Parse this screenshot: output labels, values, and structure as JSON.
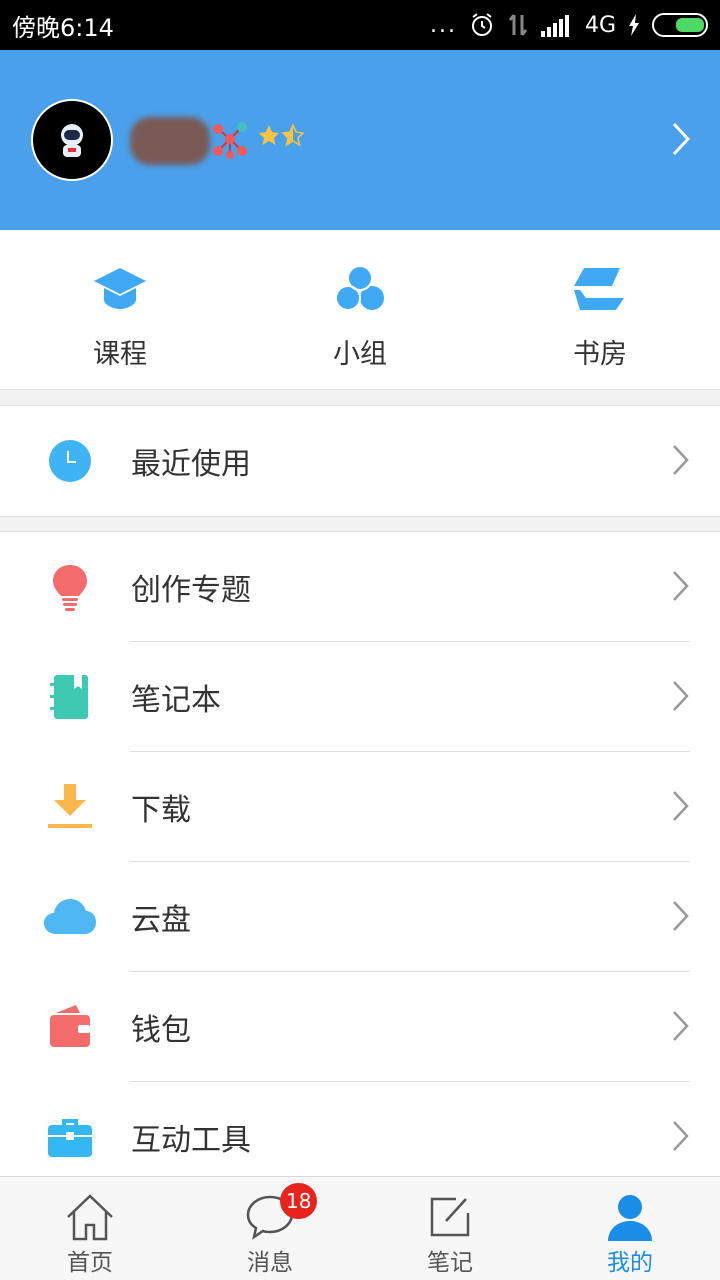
{
  "status_bar": {
    "time": "傍晚6:14",
    "dots": "...",
    "network": "4G"
  },
  "header": {
    "avatar_icon": "astronaut-icon",
    "username": "",
    "stars": 1.5
  },
  "quick_nav": [
    {
      "label": "课程",
      "icon": "graduation-cap-icon",
      "color": "#3fa9f5"
    },
    {
      "label": "小组",
      "icon": "group-circles-icon",
      "color": "#3fa9f5"
    },
    {
      "label": "书房",
      "icon": "books-icon",
      "color": "#3fa9f5"
    }
  ],
  "recent": {
    "label": "最近使用",
    "icon": "clock-icon",
    "color": "#3fb4f5"
  },
  "menu": [
    {
      "label": "创作专题",
      "icon": "lightbulb-icon",
      "color": "#f46b6b"
    },
    {
      "label": "笔记本",
      "icon": "notebook-icon",
      "color": "#3ec9b3"
    },
    {
      "label": "下载",
      "icon": "download-icon",
      "color": "#f8b84b"
    },
    {
      "label": "云盘",
      "icon": "cloud-icon",
      "color": "#4fb7f4"
    },
    {
      "label": "钱包",
      "icon": "wallet-icon",
      "color": "#f46b6b"
    },
    {
      "label": "互动工具",
      "icon": "toolbox-icon",
      "color": "#34b8f4"
    }
  ],
  "tabs": [
    {
      "label": "首页",
      "icon": "home-icon"
    },
    {
      "label": "消息",
      "icon": "chat-bubble-icon",
      "badge": "18"
    },
    {
      "label": "笔记",
      "icon": "edit-note-icon"
    },
    {
      "label": "我的",
      "icon": "profile-icon",
      "active": true
    }
  ]
}
